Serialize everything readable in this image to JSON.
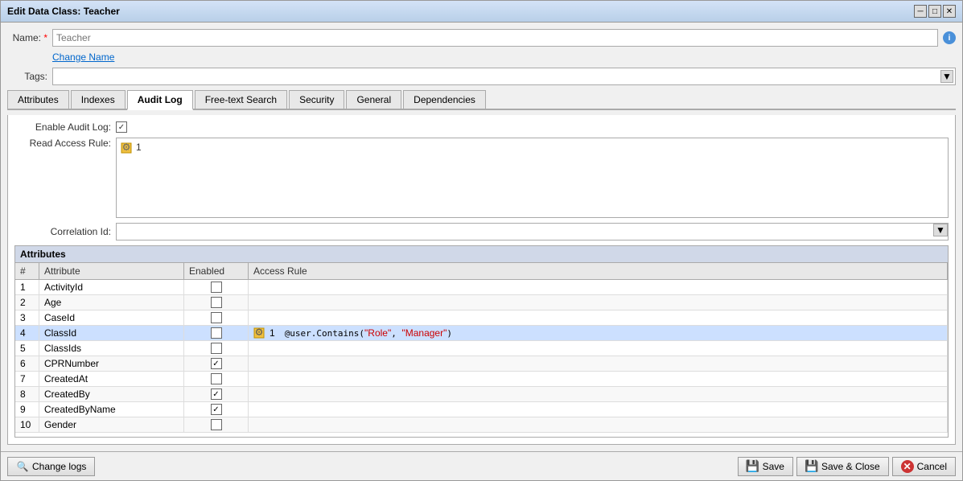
{
  "window": {
    "title": "Edit Data Class: Teacher",
    "title_btn_minimize": "─",
    "title_btn_restore": "□",
    "title_btn_close": "✕"
  },
  "form": {
    "name_label": "Name:",
    "name_required": "*",
    "name_placeholder": "Teacher",
    "info_icon": "i",
    "change_name_link": "Change Name",
    "tags_label": "Tags:"
  },
  "tabs": [
    {
      "id": "attributes",
      "label": "Attributes",
      "active": false
    },
    {
      "id": "indexes",
      "label": "Indexes",
      "active": false
    },
    {
      "id": "audit-log",
      "label": "Audit Log",
      "active": true
    },
    {
      "id": "free-text-search",
      "label": "Free-text Search",
      "active": false
    },
    {
      "id": "security",
      "label": "Security",
      "active": false
    },
    {
      "id": "general",
      "label": "General",
      "active": false
    },
    {
      "id": "dependencies",
      "label": "Dependencies",
      "active": false
    }
  ],
  "audit_tab": {
    "enable_label": "Enable Audit Log:",
    "enable_checked": true,
    "read_access_label": "Read Access Rule:",
    "read_access_number": "1",
    "correlation_label": "Correlation Id:"
  },
  "attributes_table": {
    "section_header": "Attributes",
    "columns": [
      "#",
      "Attribute",
      "Enabled",
      "Access Rule"
    ],
    "rows": [
      {
        "num": "1",
        "attribute": "ActivityId",
        "enabled": false,
        "access_rule": "",
        "active": false
      },
      {
        "num": "2",
        "attribute": "Age",
        "enabled": false,
        "access_rule": "",
        "active": false
      },
      {
        "num": "3",
        "attribute": "CaseId",
        "enabled": false,
        "access_rule": "",
        "active": false
      },
      {
        "num": "4",
        "attribute": "ClassId",
        "enabled": false,
        "access_rule": "1   @user.Contains(\"Role\", \"Manager\")",
        "active": true
      },
      {
        "num": "5",
        "attribute": "ClassIds",
        "enabled": false,
        "access_rule": "",
        "active": false
      },
      {
        "num": "6",
        "attribute": "CPRNumber",
        "enabled": true,
        "access_rule": "",
        "active": false
      },
      {
        "num": "7",
        "attribute": "CreatedAt",
        "enabled": false,
        "access_rule": "",
        "active": false
      },
      {
        "num": "8",
        "attribute": "CreatedBy",
        "enabled": true,
        "access_rule": "",
        "active": false
      },
      {
        "num": "9",
        "attribute": "CreatedByName",
        "enabled": true,
        "access_rule": "",
        "active": false
      },
      {
        "num": "10",
        "attribute": "Gender",
        "enabled": false,
        "access_rule": "",
        "active": false
      }
    ]
  },
  "bottom_bar": {
    "change_logs_label": "Change logs",
    "save_label": "Save",
    "save_close_label": "Save & Close",
    "cancel_label": "Cancel"
  }
}
